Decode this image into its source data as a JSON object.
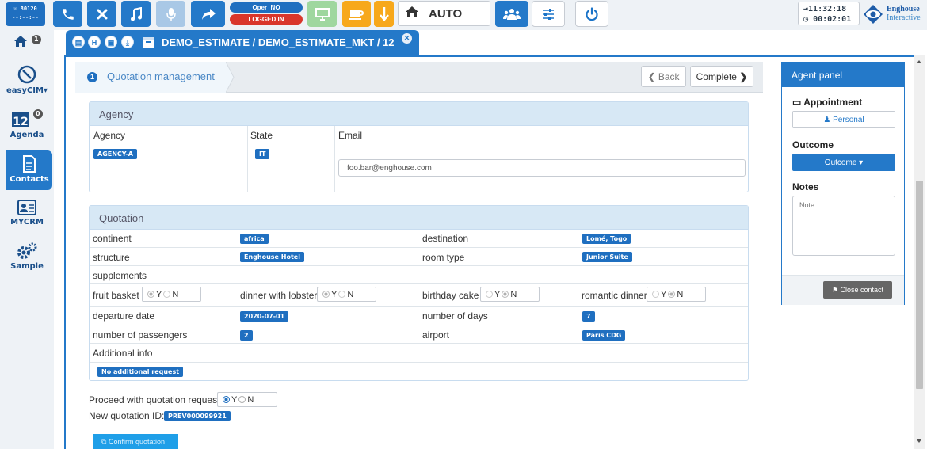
{
  "toolbar": {
    "extension": "80120",
    "extension_sub": "--:--:--",
    "oper_label": "Oper_NO",
    "status_label": "LOGGED IN",
    "mode_label": "AUTO",
    "clock_time": "11:32:18",
    "clock_duration": "00:02:01",
    "brand_line1": "Enghouse",
    "brand_line2": "Interactive"
  },
  "sidebar": {
    "home_badge": "1",
    "items": [
      {
        "label": "easyCIM"
      },
      {
        "label": "Agenda",
        "badge": "0"
      },
      {
        "label": "Contacts"
      },
      {
        "label": "MYCRM"
      },
      {
        "label": "Sample"
      }
    ]
  },
  "tab": {
    "icon_h": "H",
    "title": "DEMO_ESTIMATE / DEMO_ESTIMATE_MKT / 12"
  },
  "wizard": {
    "step_number": "1",
    "step_label": "Quotation management",
    "back_label": "Back",
    "complete_label": "Complete"
  },
  "agency": {
    "title": "Agency",
    "col_agency": "Agency",
    "col_state": "State",
    "col_email": "Email",
    "agency_value": "AGENCY-A",
    "state_value": "IT",
    "email_value": "foo.bar@enghouse.com"
  },
  "quotation": {
    "title": "Quotation",
    "continent_label": "continent",
    "continent_value": "africa",
    "destination_label": "destination",
    "destination_value": "Lomé, Togo",
    "structure_label": "structure",
    "structure_value": "Enghouse Hotel",
    "room_type_label": "room type",
    "room_type_value": "Junior Suite",
    "supplements_label": "supplements",
    "fruit_basket_label": "fruit basket",
    "dinner_lobster_label": "dinner with lobster",
    "birthday_cake_label": "birthday cake",
    "romantic_dinner_label": "romantic dinner",
    "yes": "Y",
    "no": "N",
    "departure_label": "departure date",
    "departure_value": "2020-07-01",
    "days_label": "number of days",
    "days_value": "7",
    "passengers_label": "number of passengers",
    "passengers_value": "2",
    "airport_label": "airport",
    "airport_value": "Paris CDG",
    "additional_label": "Additional info",
    "additional_value": "No additional request"
  },
  "proceed": {
    "question": "Proceed with quotation request?",
    "new_id_label": "New quotation ID:",
    "new_id_value": "PREV000099921",
    "confirm_label": "Confirm quotation"
  },
  "agent_panel": {
    "title": "Agent panel",
    "appointment_label": "Appointment",
    "personal_label": "Personal",
    "outcome_label": "Outcome",
    "outcome_button": "Outcome",
    "notes_label": "Notes",
    "notes_placeholder": "Note",
    "close_contact": "Close contact"
  },
  "colors": {
    "primary": "#2479c9",
    "danger": "#d9362b",
    "green": "#9fd79f",
    "orange": "#f7a81b"
  }
}
